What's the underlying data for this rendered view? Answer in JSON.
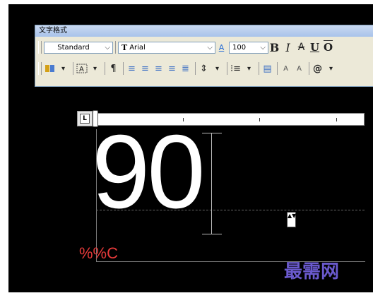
{
  "toolbar": {
    "title": "文字格式",
    "style_value": "Standard",
    "font_value": "Arial",
    "font_glyph": "T",
    "height_value": "100",
    "row1_buttons": {
      "annotative": "A",
      "bold": "B",
      "italic": "I",
      "strike": "A",
      "underline": "U",
      "overline": "O"
    },
    "row2_buttons": {
      "insert_field": "▾",
      "superscript": "A",
      "subscript": "A",
      "symbol": "@"
    }
  },
  "editor": {
    "text": "90",
    "code_text": "%%C",
    "stack_label": "▲▼"
  },
  "watermark": "最需网",
  "colors": {
    "canvas": "#000000",
    "code_text": "#e73a3a",
    "watermark": "#6a5acd"
  }
}
